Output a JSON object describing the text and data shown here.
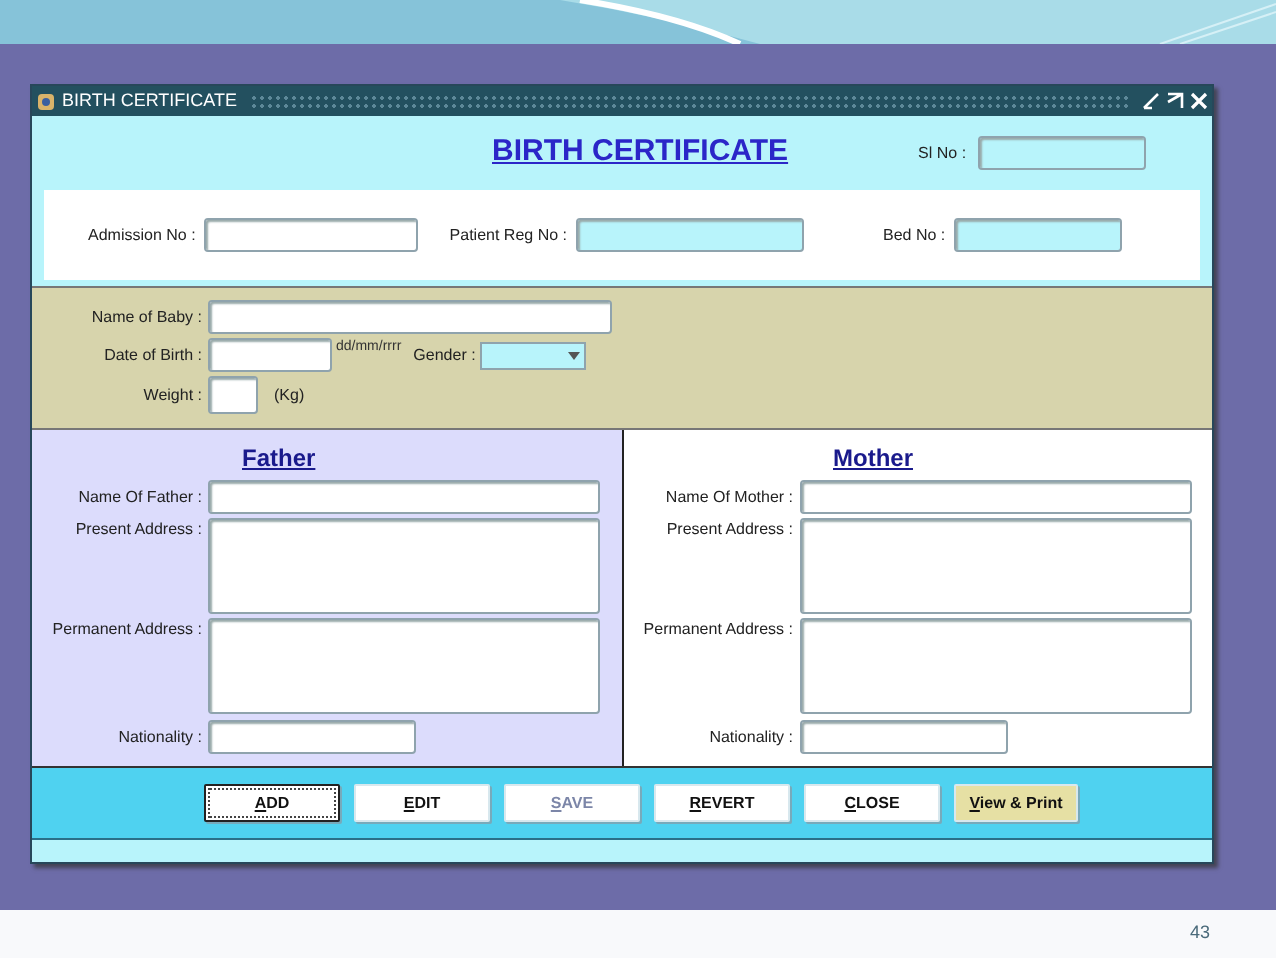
{
  "window": {
    "title": "BIRTH CERTIFICATE"
  },
  "form_title": "BIRTH CERTIFICATE",
  "serial": {
    "label": "Sl No :",
    "readonly": true
  },
  "header_fields": [
    {
      "label": "Admission No :",
      "readonly": false
    },
    {
      "label": "Patient Reg No :",
      "readonly": true
    },
    {
      "label": "Bed No :",
      "readonly": true
    }
  ],
  "baby": {
    "name_label": "Name of Baby :",
    "dob_label": "Date of Birth :",
    "dob_hint": "dd/mm/rrrr",
    "gender_label": "Gender :",
    "weight_label": "Weight :",
    "weight_unit": "(Kg)"
  },
  "parents": [
    {
      "heading": "Father",
      "name_label": "Name Of Father :",
      "present_label": "Present Address :",
      "permanent_label": "Permanent Address :",
      "nationality_label": "Nationality :",
      "shaded": true
    },
    {
      "heading": "Mother",
      "name_label": "Name Of Mother :",
      "present_label": "Present Address :",
      "permanent_label": "Permanent Address :",
      "nationality_label": "Nationality :",
      "shaded": false
    }
  ],
  "buttons": [
    {
      "label": "ADD",
      "kind": "standard",
      "focused": true,
      "disabled": false
    },
    {
      "label": "EDIT",
      "kind": "standard",
      "focused": false,
      "disabled": false
    },
    {
      "label": "SAVE",
      "kind": "standard",
      "focused": false,
      "disabled": true
    },
    {
      "label": "REVERT",
      "kind": "standard",
      "focused": false,
      "disabled": false
    },
    {
      "label": "CLOSE",
      "kind": "standard",
      "focused": false,
      "disabled": false
    },
    {
      "label": "View & Print",
      "kind": "highlight",
      "focused": false,
      "disabled": false
    }
  ],
  "slide_number": "43"
}
